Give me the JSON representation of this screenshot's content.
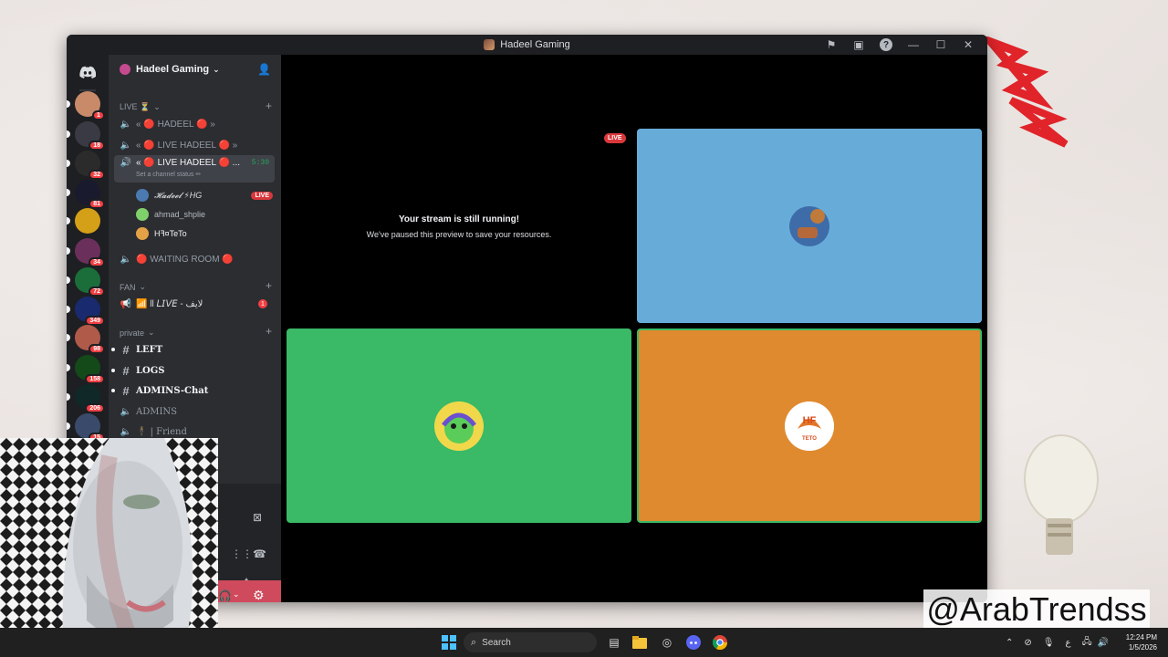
{
  "window": {
    "title": "Hadeel Gaming"
  },
  "sidebar": {
    "server_name": "Hadeel Gaming",
    "categories": {
      "live": "LIVE ⏳",
      "fan": "FAN",
      "private": "private"
    },
    "channels": {
      "hadeel": "« 🔴 HADEEL 🔴 »",
      "live_hadeel_1": "« 🔴 LIVE HADEEL 🔴 »",
      "live_hadeel_2": "« 🔴 LIVE HADEEL 🔴 ...",
      "live_hadeel_2_time": "5:30",
      "live_hadeel_2_status": "Set a channel status ✏",
      "waiting_room": "🔴 WAITING ROOM 🔴",
      "fan_live": "📶 ll 𝘓𝘐𝘝𝘌 - لايف",
      "fan_live_badge": "1",
      "left": "LEFT",
      "logs": "LOGS",
      "admins_chat": "ADMINS-Chat",
      "admins": "ADMINS",
      "friend": "🕴 | Friend"
    },
    "members": [
      {
        "name": "𝓗𝓪𝓭𝓮𝓮𝓵 ⚡HG",
        "live": "LIVE"
      },
      {
        "name": "ahmad_shplie"
      },
      {
        "name": "Hꟻ¤TeTo"
      }
    ]
  },
  "servers": [
    {
      "badge": "1",
      "color": "#c98a6a"
    },
    {
      "badge": "18",
      "color": "#3a3a44"
    },
    {
      "badge": "32",
      "color": "#2b2b2b"
    },
    {
      "badge": "81",
      "color": "#1a1a2e"
    },
    {
      "badge": "",
      "color": "#d4a017"
    },
    {
      "badge": "34",
      "color": "#6a2f5a"
    },
    {
      "badge": "72",
      "color": "#1b6e3a"
    },
    {
      "badge": "349",
      "color": "#1a2a6e"
    },
    {
      "badge": "98",
      "color": "#b05a4a"
    },
    {
      "badge": "158",
      "color": "#144a1a"
    },
    {
      "badge": "206",
      "color": "#102828"
    },
    {
      "badge": "15",
      "color": "#3a4a6a"
    }
  ],
  "stage": {
    "paused_title": "Your stream is still running!",
    "paused_subtitle": "We've paused this preview to save your resources.",
    "live_tag": "LIVE",
    "tile_colors": {
      "blue": "#67acd9",
      "green": "#3ab966",
      "orange": "#df8a2f"
    },
    "teto_label": "TETO"
  },
  "taskbar": {
    "search_placeholder": "Search",
    "time": "12:24 PM",
    "date": "1/5/2026",
    "lang": "ع"
  },
  "overlay": {
    "watermark": "@ArabTrendss"
  }
}
